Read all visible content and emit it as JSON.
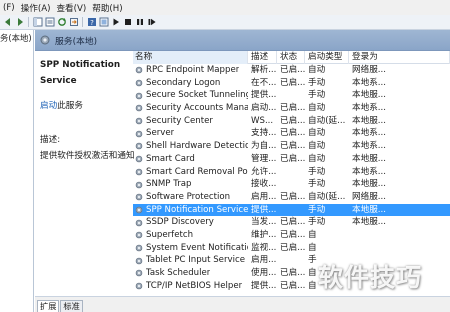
{
  "menu": [
    "(F)",
    "操作(A)",
    "查看(V)",
    "帮助(H)"
  ],
  "tree": {
    "item": "务(本地)"
  },
  "header": {
    "title": "服务(本地)"
  },
  "description": {
    "service_name": "SPP Notification Service",
    "start_link": "启动",
    "start_link_rest": "此服务",
    "desc_label": "描述:",
    "desc_text": "提供软件授权激活和通知"
  },
  "table": {
    "columns": [
      "名称",
      "描述",
      "状态",
      "启动类型",
      "登录为"
    ],
    "rows": [
      {
        "name": "RPC Endpoint Mapper",
        "desc": "解析...",
        "status": "已启...",
        "start": "自动",
        "logon": "网络服..."
      },
      {
        "name": "Secondary Logon",
        "desc": "在不...",
        "status": "已启...",
        "start": "手动",
        "logon": "本地系..."
      },
      {
        "name": "Secure Socket Tunneling ...",
        "desc": "提供...",
        "status": "",
        "start": "手动",
        "logon": "本地服..."
      },
      {
        "name": "Security Accounts Mana...",
        "desc": "启动...",
        "status": "已启...",
        "start": "自动",
        "logon": "本地系..."
      },
      {
        "name": "Security Center",
        "desc": "WS...",
        "status": "已启...",
        "start": "自动(延...",
        "logon": "本地服..."
      },
      {
        "name": "Server",
        "desc": "支持...",
        "status": "已启...",
        "start": "自动",
        "logon": "本地系..."
      },
      {
        "name": "Shell Hardware Detection",
        "desc": "为自...",
        "status": "已启...",
        "start": "自动",
        "logon": "本地系..."
      },
      {
        "name": "Smart Card",
        "desc": "管理...",
        "status": "已启...",
        "start": "自动",
        "logon": "本地服..."
      },
      {
        "name": "Smart Card Removal Poli...",
        "desc": "允许...",
        "status": "",
        "start": "手动",
        "logon": "本地系..."
      },
      {
        "name": "SNMP Trap",
        "desc": "接收...",
        "status": "",
        "start": "手动",
        "logon": "本地服..."
      },
      {
        "name": "Software Protection",
        "desc": "启用...",
        "status": "已启...",
        "start": "自动(延...",
        "logon": "网络服..."
      },
      {
        "name": "SPP Notification Service",
        "desc": "提供...",
        "status": "",
        "start": "手动",
        "logon": "本地服..."
      },
      {
        "name": "SSDP Discovery",
        "desc": "当发...",
        "status": "已启...",
        "start": "手动",
        "logon": "本地服..."
      },
      {
        "name": "Superfetch",
        "desc": "维护...",
        "status": "已启...",
        "start": "自",
        "logon": ""
      },
      {
        "name": "System Event Notificatio...",
        "desc": "监视...",
        "status": "已启...",
        "start": "自",
        "logon": ""
      },
      {
        "name": "Tablet PC Input Service",
        "desc": "启用...",
        "status": "",
        "start": "手",
        "logon": ""
      },
      {
        "name": "Task Scheduler",
        "desc": "使用...",
        "status": "已启...",
        "start": "自",
        "logon": ""
      },
      {
        "name": "TCP/IP NetBIOS Helper",
        "desc": "提供...",
        "status": "已启...",
        "start": "自",
        "logon": ""
      }
    ],
    "selected_index": 11
  },
  "tabs": [
    "扩展",
    "标准"
  ],
  "watermark": "软件技巧",
  "colors": {
    "selection": "#3399ff",
    "header_bar": "#9fb6d3",
    "link": "#1a5fb4"
  }
}
